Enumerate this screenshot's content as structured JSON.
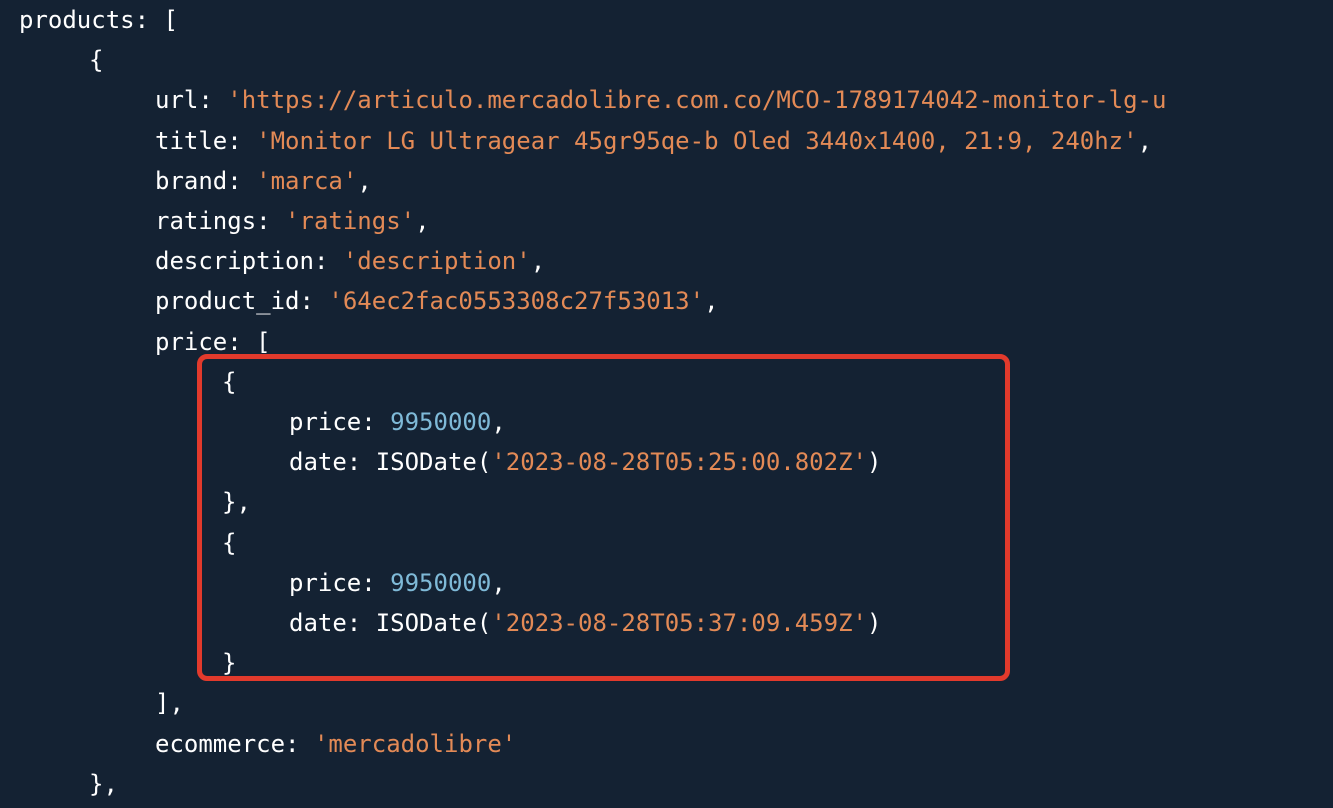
{
  "colors": {
    "background": "#142233",
    "key": "#ffffff",
    "string": "#e38a56",
    "number": "#7fbad8",
    "highlight_border": "#e23a2c"
  },
  "lines": [
    {
      "indent": 0,
      "parts": [
        {
          "t": "k",
          "v": "products: ["
        }
      ]
    },
    {
      "indent": 1,
      "parts": [
        {
          "t": "k",
          "v": "{"
        }
      ]
    },
    {
      "indent": 2,
      "parts": [
        {
          "t": "k",
          "v": "url: "
        },
        {
          "t": "s",
          "v": "'https://articulo.mercadolibre.com.co/MCO-1789174042-monitor-lg-u"
        }
      ]
    },
    {
      "indent": 2,
      "parts": [
        {
          "t": "k",
          "v": "title: "
        },
        {
          "t": "s",
          "v": "'Monitor LG Ultragear 45gr95qe-b Oled 3440x1400, 21:9, 240hz'"
        },
        {
          "t": "k",
          "v": ","
        }
      ]
    },
    {
      "indent": 2,
      "parts": [
        {
          "t": "k",
          "v": "brand: "
        },
        {
          "t": "s",
          "v": "'marca'"
        },
        {
          "t": "k",
          "v": ","
        }
      ]
    },
    {
      "indent": 2,
      "parts": [
        {
          "t": "k",
          "v": "ratings: "
        },
        {
          "t": "s",
          "v": "'ratings'"
        },
        {
          "t": "k",
          "v": ","
        }
      ]
    },
    {
      "indent": 2,
      "parts": [
        {
          "t": "k",
          "v": "description: "
        },
        {
          "t": "s",
          "v": "'description'"
        },
        {
          "t": "k",
          "v": ","
        }
      ]
    },
    {
      "indent": 2,
      "parts": [
        {
          "t": "k",
          "v": "product_id: "
        },
        {
          "t": "s",
          "v": "'64ec2fac0553308c27f53013'"
        },
        {
          "t": "k",
          "v": ","
        }
      ]
    },
    {
      "indent": 2,
      "parts": [
        {
          "t": "k",
          "v": "price: ["
        }
      ]
    },
    {
      "indent": 3,
      "parts": [
        {
          "t": "k",
          "v": "{"
        }
      ]
    },
    {
      "indent": 4,
      "parts": [
        {
          "t": "k",
          "v": "price: "
        },
        {
          "t": "n",
          "v": "9950000"
        },
        {
          "t": "k",
          "v": ","
        }
      ]
    },
    {
      "indent": 4,
      "parts": [
        {
          "t": "k",
          "v": "date: ISODate("
        },
        {
          "t": "s",
          "v": "'2023-08-28T05:25:00.802Z'"
        },
        {
          "t": "k",
          "v": ")"
        }
      ]
    },
    {
      "indent": 3,
      "parts": [
        {
          "t": "k",
          "v": "},"
        }
      ]
    },
    {
      "indent": 3,
      "parts": [
        {
          "t": "k",
          "v": "{"
        }
      ]
    },
    {
      "indent": 4,
      "parts": [
        {
          "t": "k",
          "v": "price: "
        },
        {
          "t": "n",
          "v": "9950000"
        },
        {
          "t": "k",
          "v": ","
        }
      ]
    },
    {
      "indent": 4,
      "parts": [
        {
          "t": "k",
          "v": "date: ISODate("
        },
        {
          "t": "s",
          "v": "'2023-08-28T05:37:09.459Z'"
        },
        {
          "t": "k",
          "v": ")"
        }
      ]
    },
    {
      "indent": 3,
      "parts": [
        {
          "t": "k",
          "v": "}"
        }
      ]
    },
    {
      "indent": 2,
      "parts": [
        {
          "t": "k",
          "v": "],"
        }
      ]
    },
    {
      "indent": 2,
      "parts": [
        {
          "t": "k",
          "v": "ecommerce: "
        },
        {
          "t": "s",
          "v": "'mercadolibre'"
        }
      ]
    },
    {
      "indent": 1,
      "parts": [
        {
          "t": "k",
          "v": "},"
        }
      ]
    }
  ]
}
